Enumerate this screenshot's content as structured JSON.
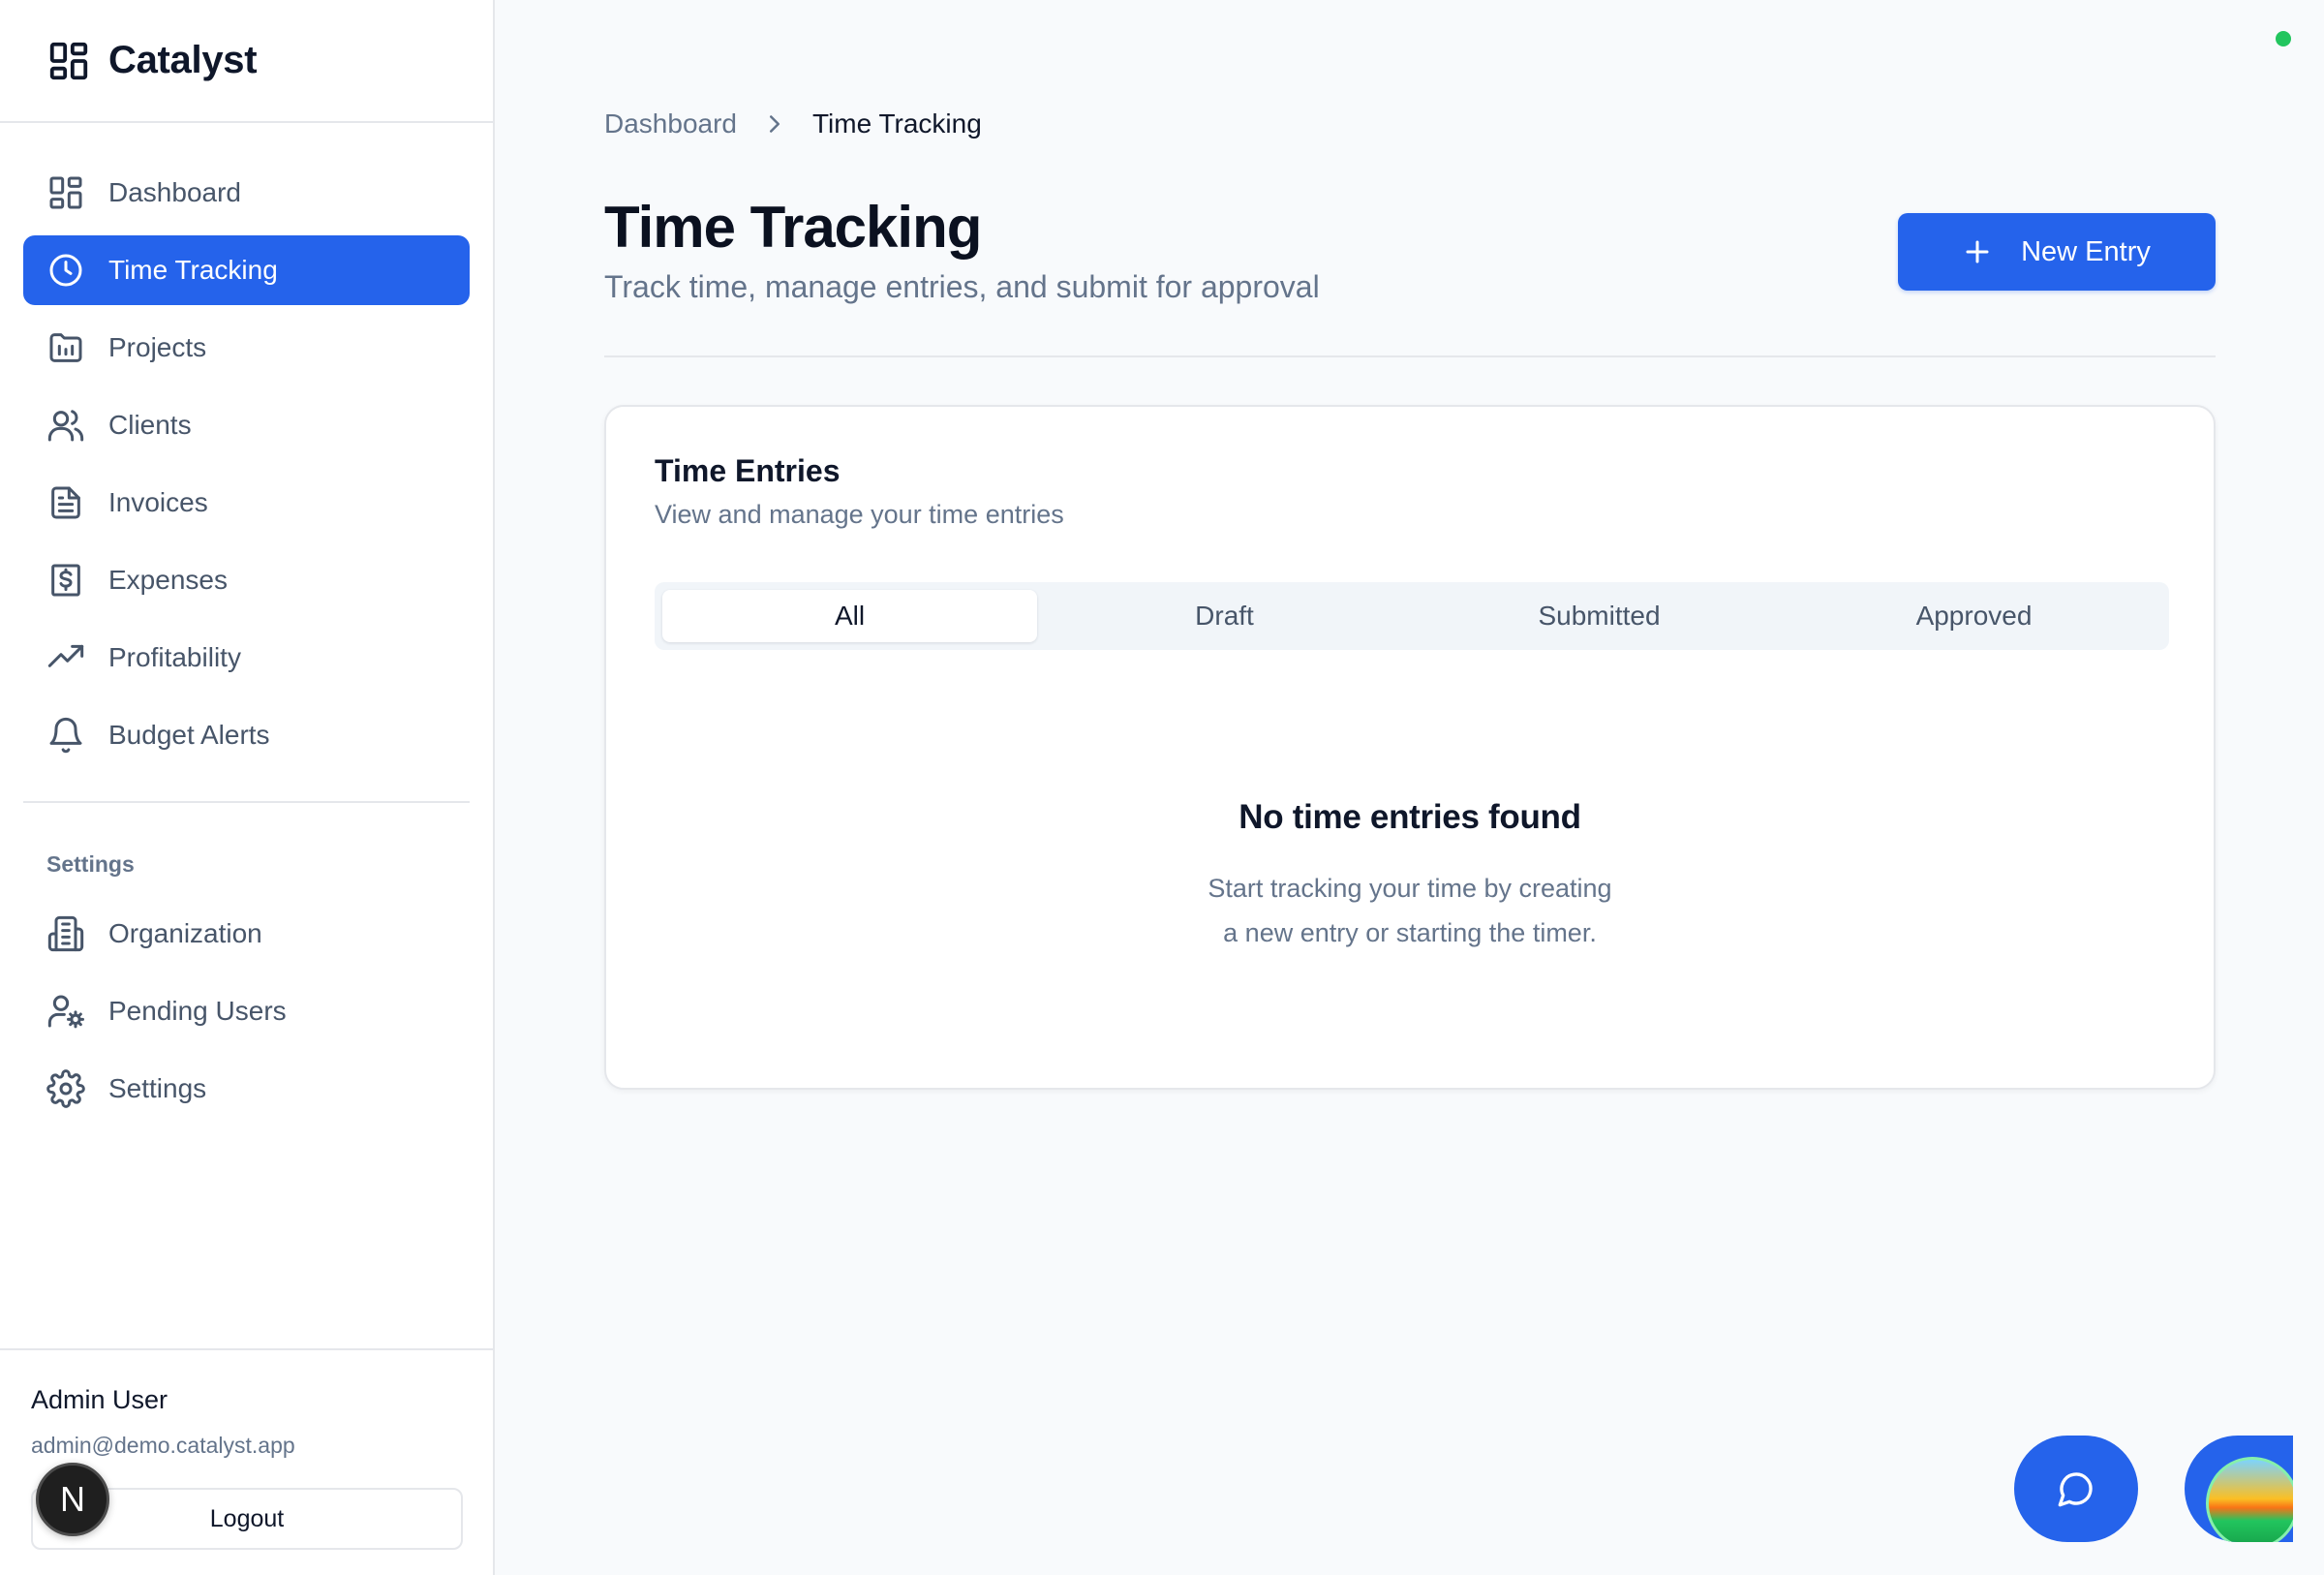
{
  "brand": {
    "name": "Catalyst",
    "icon": "layout-grid-icon"
  },
  "sidebar": {
    "items": [
      {
        "label": "Dashboard",
        "icon": "layout-dashboard-icon"
      },
      {
        "label": "Time Tracking",
        "icon": "clock-icon",
        "active": true
      },
      {
        "label": "Projects",
        "icon": "folder-chart-icon"
      },
      {
        "label": "Clients",
        "icon": "users-icon"
      },
      {
        "label": "Invoices",
        "icon": "file-text-icon"
      },
      {
        "label": "Expenses",
        "icon": "receipt-dollar-icon"
      },
      {
        "label": "Profitability",
        "icon": "trending-up-icon"
      },
      {
        "label": "Budget Alerts",
        "icon": "bell-icon"
      }
    ],
    "settings_label": "Settings",
    "settings_items": [
      {
        "label": "Organization",
        "icon": "building-icon"
      },
      {
        "label": "Pending Users",
        "icon": "user-cog-icon"
      },
      {
        "label": "Settings",
        "icon": "gear-icon"
      }
    ],
    "user": {
      "name": "Admin User",
      "email": "admin@demo.catalyst.app",
      "logout_label": "Logout"
    },
    "badge_letter": "N"
  },
  "breadcrumb": {
    "parent": "Dashboard",
    "current": "Time Tracking"
  },
  "header": {
    "title": "Time Tracking",
    "subtitle": "Track time, manage entries, and submit for approval",
    "new_entry_label": "New Entry"
  },
  "card": {
    "title": "Time Entries",
    "subtitle": "View and manage your time entries",
    "tabs": [
      {
        "label": "All",
        "active": true
      },
      {
        "label": "Draft"
      },
      {
        "label": "Submitted"
      },
      {
        "label": "Approved"
      }
    ],
    "empty_title": "No time entries found",
    "empty_line1": "Start tracking your time by creating",
    "empty_line2": "a new entry or starting the timer."
  },
  "colors": {
    "accent": "#2563eb",
    "status_online": "#22c55e",
    "background": "#f8fafc"
  }
}
